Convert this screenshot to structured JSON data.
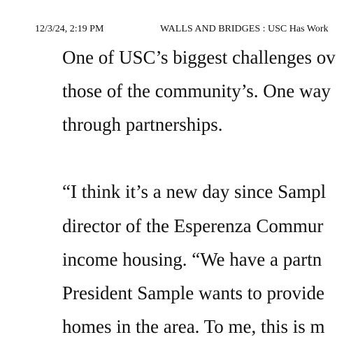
{
  "header": {
    "timestamp": "12/3/24, 2:19 PM",
    "title": "WALLS AND BRIDGES : USC Has Work"
  },
  "paragraphs": [
    {
      "lines": [
        "One of USC’s biggest challenges ov",
        "those of the community’s. One way",
        "through partnerships."
      ]
    },
    {
      "lines": [
        "“I think it’s a new day since Sampl",
        "director of the Esperenza Commur",
        "income housing. “We have a partn",
        "President Sample wants to provide",
        "homes in the area. To me, this is m"
      ]
    }
  ]
}
